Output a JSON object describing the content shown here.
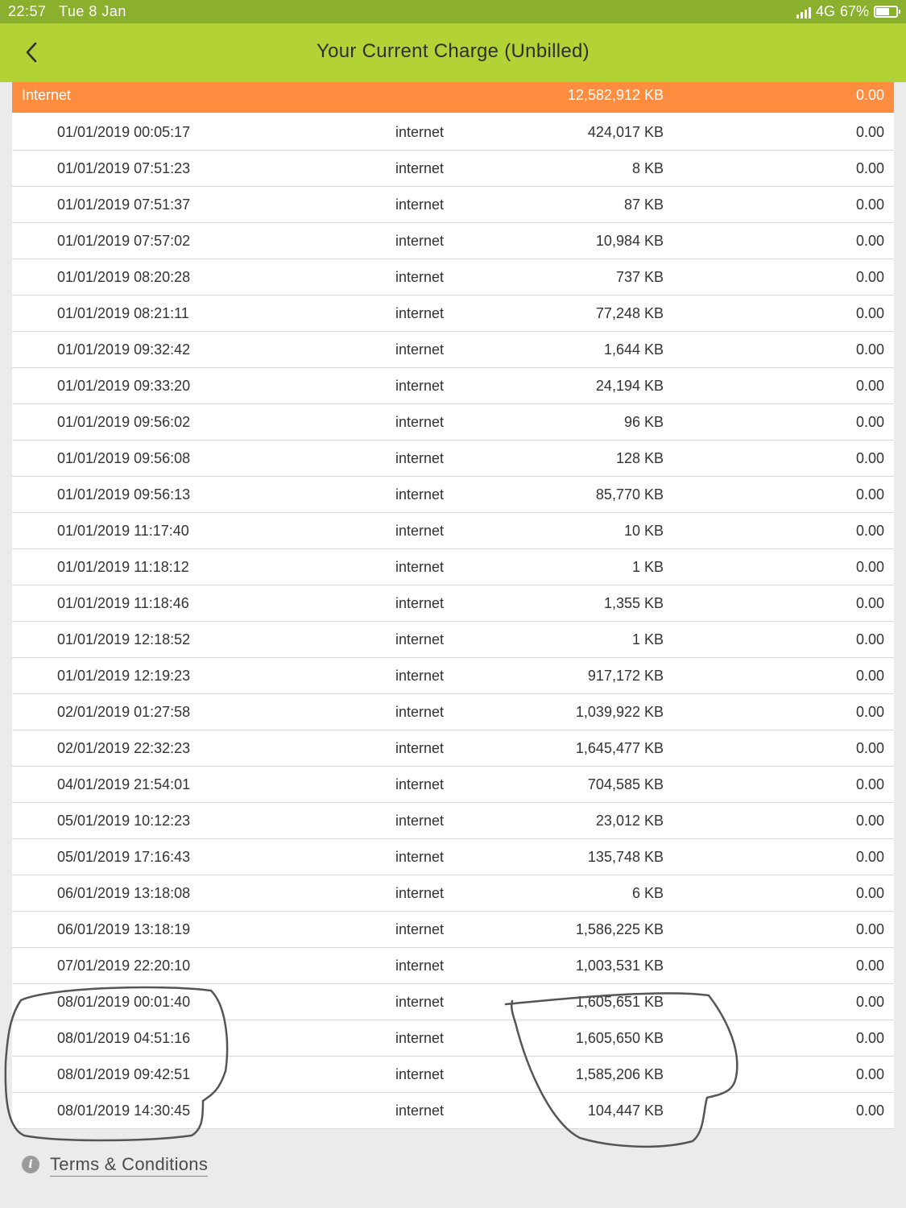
{
  "status_bar": {
    "time": "22:57",
    "date": "Tue 8 Jan",
    "network": "4G",
    "battery": "67%",
    "battery_level": 0.67
  },
  "header": {
    "title": "Your Current Charge (Unbilled)",
    "back_icon": "chevron-left-icon"
  },
  "table": {
    "summary": {
      "label": "Internet",
      "volume": "12,582,912 KB",
      "charge": "0.00"
    },
    "rows": [
      {
        "datetime": "01/01/2019 00:05:17",
        "type": "internet",
        "volume": "424,017 KB",
        "charge": "0.00"
      },
      {
        "datetime": "01/01/2019 07:51:23",
        "type": "internet",
        "volume": "8 KB",
        "charge": "0.00"
      },
      {
        "datetime": "01/01/2019 07:51:37",
        "type": "internet",
        "volume": "87 KB",
        "charge": "0.00"
      },
      {
        "datetime": "01/01/2019 07:57:02",
        "type": "internet",
        "volume": "10,984 KB",
        "charge": "0.00"
      },
      {
        "datetime": "01/01/2019 08:20:28",
        "type": "internet",
        "volume": "737 KB",
        "charge": "0.00"
      },
      {
        "datetime": "01/01/2019 08:21:11",
        "type": "internet",
        "volume": "77,248 KB",
        "charge": "0.00"
      },
      {
        "datetime": "01/01/2019 09:32:42",
        "type": "internet",
        "volume": "1,644 KB",
        "charge": "0.00"
      },
      {
        "datetime": "01/01/2019 09:33:20",
        "type": "internet",
        "volume": "24,194 KB",
        "charge": "0.00"
      },
      {
        "datetime": "01/01/2019 09:56:02",
        "type": "internet",
        "volume": "96 KB",
        "charge": "0.00"
      },
      {
        "datetime": "01/01/2019 09:56:08",
        "type": "internet",
        "volume": "128 KB",
        "charge": "0.00"
      },
      {
        "datetime": "01/01/2019 09:56:13",
        "type": "internet",
        "volume": "85,770 KB",
        "charge": "0.00"
      },
      {
        "datetime": "01/01/2019 11:17:40",
        "type": "internet",
        "volume": "10 KB",
        "charge": "0.00"
      },
      {
        "datetime": "01/01/2019 11:18:12",
        "type": "internet",
        "volume": "1 KB",
        "charge": "0.00"
      },
      {
        "datetime": "01/01/2019 11:18:46",
        "type": "internet",
        "volume": "1,355 KB",
        "charge": "0.00"
      },
      {
        "datetime": "01/01/2019 12:18:52",
        "type": "internet",
        "volume": "1 KB",
        "charge": "0.00"
      },
      {
        "datetime": "01/01/2019 12:19:23",
        "type": "internet",
        "volume": "917,172 KB",
        "charge": "0.00"
      },
      {
        "datetime": "02/01/2019 01:27:58",
        "type": "internet",
        "volume": "1,039,922 KB",
        "charge": "0.00"
      },
      {
        "datetime": "02/01/2019 22:32:23",
        "type": "internet",
        "volume": "1,645,477 KB",
        "charge": "0.00"
      },
      {
        "datetime": "04/01/2019 21:54:01",
        "type": "internet",
        "volume": "704,585 KB",
        "charge": "0.00"
      },
      {
        "datetime": "05/01/2019 10:12:23",
        "type": "internet",
        "volume": "23,012 KB",
        "charge": "0.00"
      },
      {
        "datetime": "05/01/2019 17:16:43",
        "type": "internet",
        "volume": "135,748 KB",
        "charge": "0.00"
      },
      {
        "datetime": "06/01/2019 13:18:08",
        "type": "internet",
        "volume": "6 KB",
        "charge": "0.00"
      },
      {
        "datetime": "06/01/2019 13:18:19",
        "type": "internet",
        "volume": "1,586,225 KB",
        "charge": "0.00"
      },
      {
        "datetime": "07/01/2019 22:20:10",
        "type": "internet",
        "volume": "1,003,531 KB",
        "charge": "0.00"
      },
      {
        "datetime": "08/01/2019 00:01:40",
        "type": "internet",
        "volume": "1,605,651 KB",
        "charge": "0.00"
      },
      {
        "datetime": "08/01/2019 04:51:16",
        "type": "internet",
        "volume": "1,605,650 KB",
        "charge": "0.00"
      },
      {
        "datetime": "08/01/2019 09:42:51",
        "type": "internet",
        "volume": "1,585,206 KB",
        "charge": "0.00"
      },
      {
        "datetime": "08/01/2019 14:30:45",
        "type": "internet",
        "volume": "104,447 KB",
        "charge": "0.00"
      }
    ]
  },
  "footer": {
    "info_icon": "info-icon",
    "terms_label": "Terms & Conditions"
  },
  "colors": {
    "status_bar": "#8ab02e",
    "header": "#b2d235",
    "summary_row": "#ff8d3f",
    "row_background": "#ffffff",
    "page_background": "#ebebeb"
  }
}
